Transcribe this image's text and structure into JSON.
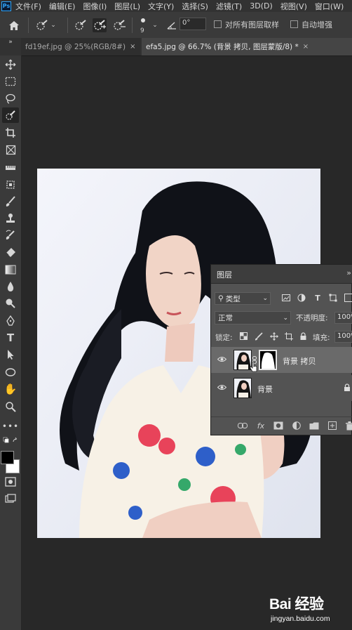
{
  "app": {
    "logo_text": "Ps"
  },
  "menu": [
    "文件(F)",
    "编辑(E)",
    "图像(I)",
    "图层(L)",
    "文字(Y)",
    "选择(S)",
    "滤镜(T)",
    "3D(D)",
    "视图(V)",
    "窗口(W)"
  ],
  "options_bar": {
    "brush_size": "9",
    "angle_value": "0°",
    "sample_all_layers_label": "对所有图层取样",
    "auto_enhance_label": "自动增强",
    "icons": [
      "home-icon",
      "quick-selection-icon",
      "new-selection-icon",
      "add-to-selection-icon",
      "subtract-from-selection-icon",
      "brush-preset-icon",
      "angle-icon"
    ]
  },
  "tabs": [
    {
      "label": "fd19ef.jpg @ 25%(RGB/8#)",
      "close": "×",
      "active": false
    },
    {
      "label": "efa5.jpg @ 66.7% (背景 拷贝, 图层蒙版/8) *",
      "close": "×",
      "active": true
    }
  ],
  "toolbar": {
    "collapse_label": "»",
    "tools": [
      "move-tool",
      "marquee-tool",
      "lasso-tool",
      "quick-selection-tool",
      "crop-tool",
      "frame-tool",
      "eyedropper-tool",
      "healing-brush-tool",
      "brush-tool",
      "clone-stamp-tool",
      "history-brush-tool",
      "eraser-tool",
      "gradient-tool",
      "blur-tool",
      "dodge-tool",
      "pen-tool",
      "type-tool",
      "path-selection-tool",
      "ellipse-tool",
      "hand-tool",
      "zoom-tool",
      "more-tools",
      "default-colors",
      "foreground-color",
      "quick-mask",
      "screen-mode"
    ],
    "foreground_color": "#000000",
    "background_color": "#ffffff"
  },
  "layers_panel": {
    "title": "图层",
    "collapse_label": "»",
    "kind_filter": "类型",
    "blend_mode": "正常",
    "opacity_label": "不透明度:",
    "opacity_value": "100%",
    "lock_label": "锁定:",
    "fill_label": "填充:",
    "fill_value": "100%",
    "layers": [
      {
        "name": "背景 拷贝",
        "visible": true,
        "has_mask": true,
        "selected": true
      },
      {
        "name": "背景",
        "visible": true,
        "locked": true,
        "selected": false
      }
    ],
    "footer_icons": [
      "link-layers-icon",
      "fx-icon",
      "add-mask-icon",
      "adjustment-layer-icon",
      "group-icon",
      "new-layer-icon",
      "delete-layer-icon"
    ],
    "fx_label": "fx"
  },
  "watermark": {
    "logo": "Bai 经验",
    "url": "jingyan.baidu.com"
  },
  "colors": {
    "accent": "#31a8ff",
    "panel_bg": "#535353",
    "selected_row": "#6a6a6a"
  }
}
